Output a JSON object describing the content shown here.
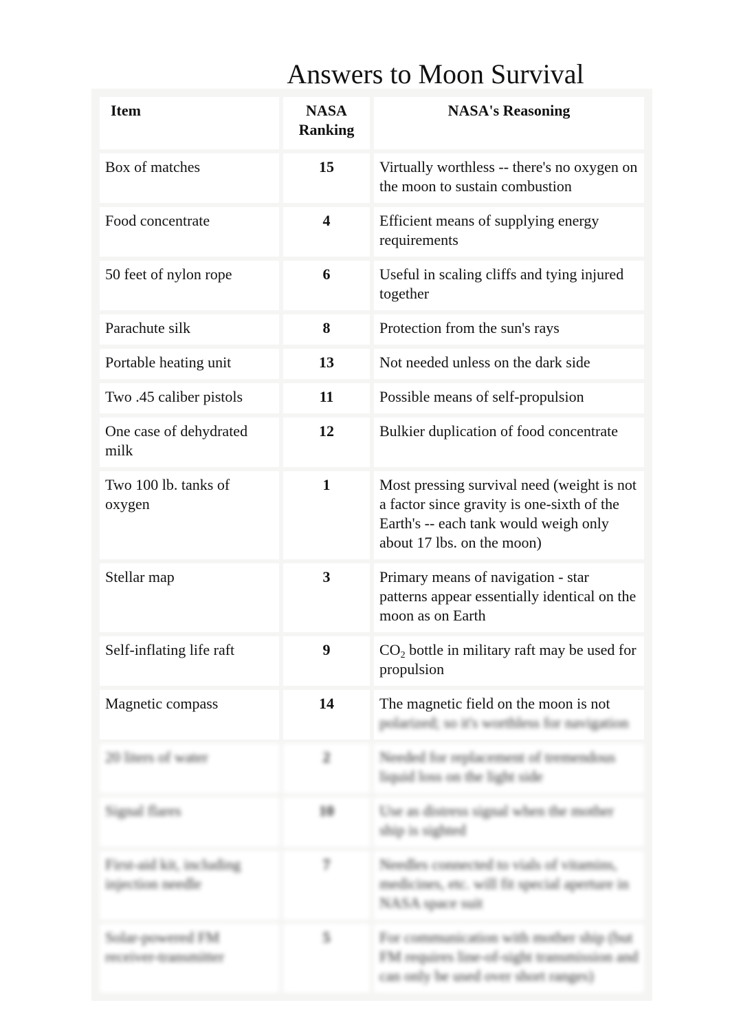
{
  "title": "Answers to Moon Survival",
  "table": {
    "headers": {
      "item": "Item",
      "ranking": "NASA Ranking",
      "reasoning": "NASA's Reasoning"
    },
    "rows": [
      {
        "item": "Box of matches",
        "rank": "15",
        "reason": "Virtually worthless -- there's no oxygen on the moon to sustain combustion"
      },
      {
        "item": "Food concentrate",
        "rank": "4",
        "reason": "Efficient means of supplying energy requirements"
      },
      {
        "item": "50 feet of nylon rope",
        "rank": "6",
        "reason": "Useful in scaling cliffs and tying injured together"
      },
      {
        "item": "Parachute silk",
        "rank": "8",
        "reason": "Protection from the sun's rays"
      },
      {
        "item": "Portable heating unit",
        "rank": "13",
        "reason": "Not needed unless on the dark side"
      },
      {
        "item": "Two .45 caliber pistols",
        "rank": "11",
        "reason": "Possible means of self-propulsion"
      },
      {
        "item": "One case of dehydrated milk",
        "rank": "12",
        "reason": "Bulkier duplication of food concentrate"
      },
      {
        "item": "Two 100 lb. tanks of oxygen",
        "rank": "1",
        "reason": "Most pressing survival need (weight is not a factor since gravity is one-sixth of the Earth's -- each tank would weigh only about 17 lbs. on the moon)"
      },
      {
        "item": "Stellar map",
        "rank": "3",
        "reason": "Primary means of navigation - star patterns appear essentially identical on the moon as on Earth"
      },
      {
        "item": "Self-inflating life raft",
        "rank": "9",
        "reason_prefix": "CO",
        "reason_sub": "2",
        "reason": " bottle in military raft may be used for propulsion"
      },
      {
        "item": "Magnetic compass",
        "rank": "14",
        "reason": "The magnetic field on the moon is not",
        "reason_blurred": "polarized; so it's worthless for navigation"
      }
    ],
    "blurred_rows": [
      {
        "item": "20 liters of water",
        "rank": "2",
        "reason": "Needed for replacement of tremendous liquid loss on the light side"
      },
      {
        "item": "Signal flares",
        "rank": "10",
        "reason": "Use as distress signal when the mother ship is sighted"
      },
      {
        "item": "First-aid kit, including injection needle",
        "rank": "7",
        "reason": "Needles connected to vials of vitamins, medicines, etc. will fit special aperture in NASA space suit"
      },
      {
        "item": "Solar-powered FM receiver-transmitter",
        "rank": "5",
        "reason": "For communication with mother ship (but FM requires line-of-sight transmission and can only be used over short ranges)"
      }
    ]
  }
}
